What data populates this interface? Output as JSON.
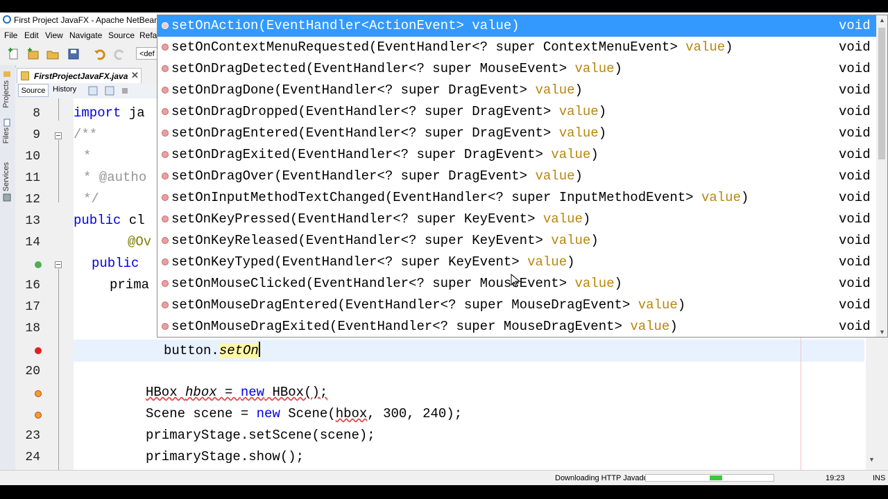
{
  "window": {
    "title": "First Project JavaFX - Apache NetBeans ID"
  },
  "menu": [
    "File",
    "Edit",
    "View",
    "Navigate",
    "Source",
    "Refa"
  ],
  "toolbar": {
    "config_combo": "<def"
  },
  "sidebar": {
    "tabs": [
      "Projects",
      "Files",
      "Services"
    ]
  },
  "editor_tab": {
    "file_name": "FirstProjectJavaFX.java",
    "close_glyph": "✕"
  },
  "editor_toolbar": {
    "source_label": "Source",
    "history_label": "History"
  },
  "line_numbers": [
    "8",
    "9",
    "10",
    "11",
    "12",
    "13",
    "14",
    "16",
    "17",
    "18",
    "20",
    "23",
    "24"
  ],
  "code": {
    "l8_kw": "import",
    "l8_rest": " ja",
    "l9": "/**",
    "l10": "*",
    "l11": "* @autho",
    "l12": "*/",
    "l13_kw": "public",
    "l13_rest": " cl",
    "l14": "@Ov",
    "l15_kw": "public",
    "l16": "prima",
    "l19_obj": "button.",
    "l19_typed": "setOn",
    "l21_type": "HBox ",
    "l21_var": "hbox",
    "l21_eq": " = ",
    "l21_new": "new",
    "l21_rest": " HBox();",
    "l22_pre": "Scene scene = ",
    "l22_new": "new",
    "l22_mid": " Scene(",
    "l22_arg": "hbox",
    "l22_rest": ", 300, 240);",
    "l23": "primaryStage.setScene(scene);",
    "l24": "primaryStage.show();"
  },
  "completion": {
    "items": [
      {
        "sig": "setOnAction(EventHandler<ActionEvent> ",
        "val": "value",
        "close": ")",
        "ret": "void",
        "selected": true
      },
      {
        "sig": "setOnContextMenuRequested(EventHandler<? super ContextMenuEvent> ",
        "val": "value",
        "close": ")",
        "ret": "void"
      },
      {
        "sig": "setOnDragDetected(EventHandler<? super MouseEvent> ",
        "val": "value",
        "close": ")",
        "ret": "void"
      },
      {
        "sig": "setOnDragDone(EventHandler<? super DragEvent> ",
        "val": "value",
        "close": ")",
        "ret": "void"
      },
      {
        "sig": "setOnDragDropped(EventHandler<? super DragEvent> ",
        "val": "value",
        "close": ")",
        "ret": "void"
      },
      {
        "sig": "setOnDragEntered(EventHandler<? super DragEvent> ",
        "val": "value",
        "close": ")",
        "ret": "void"
      },
      {
        "sig": "setOnDragExited(EventHandler<? super DragEvent> ",
        "val": "value",
        "close": ")",
        "ret": "void"
      },
      {
        "sig": "setOnDragOver(EventHandler<? super DragEvent> ",
        "val": "value",
        "close": ")",
        "ret": "void"
      },
      {
        "sig": "setOnInputMethodTextChanged(EventHandler<? super InputMethodEvent> ",
        "val": "value",
        "close": ")",
        "ret": "void"
      },
      {
        "sig": "setOnKeyPressed(EventHandler<? super KeyEvent> ",
        "val": "value",
        "close": ")",
        "ret": "void"
      },
      {
        "sig": "setOnKeyReleased(EventHandler<? super KeyEvent> ",
        "val": "value",
        "close": ")",
        "ret": "void"
      },
      {
        "sig": "setOnKeyTyped(EventHandler<? super KeyEvent> ",
        "val": "value",
        "close": ")",
        "ret": "void"
      },
      {
        "sig": "setOnMouseClicked(EventHandler<? super MouseEvent> ",
        "val": "value",
        "close": ")",
        "ret": "void"
      },
      {
        "sig": "setOnMouseDragEntered(EventHandler<? super MouseDragEvent> ",
        "val": "value",
        "close": ")",
        "ret": "void"
      },
      {
        "sig": "setOnMouseDragExited(EventHandler<? super MouseDragEvent> ",
        "val": "value",
        "close": ")",
        "ret": "void"
      }
    ]
  },
  "status": {
    "message": "Downloading HTTP Javadoc",
    "progress": 0.15,
    "caret_position": "19:23",
    "insert_mode": "INS"
  },
  "colors": {
    "selection": "#3399ff",
    "keyword": "#0000e6",
    "param_value": "#b8860b",
    "progress_fill": "#3cc83c"
  }
}
